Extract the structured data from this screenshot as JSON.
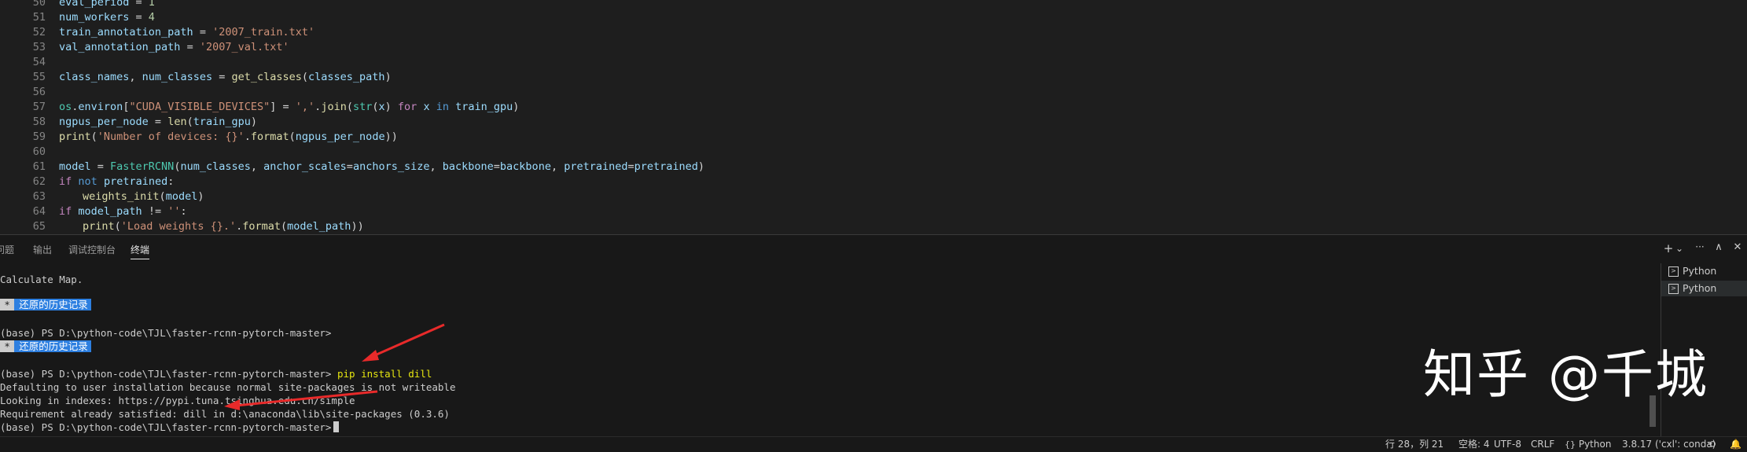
{
  "editor": {
    "lines": [
      {
        "n": "50",
        "tokens": [
          [
            "var",
            "eval_period"
          ],
          [
            "op",
            " = "
          ],
          [
            "num",
            "1"
          ]
        ],
        "indent": 1
      },
      {
        "n": "51",
        "tokens": [
          [
            "var",
            "num_workers"
          ],
          [
            "op",
            " = "
          ],
          [
            "num",
            "4"
          ]
        ],
        "indent": 1
      },
      {
        "n": "52",
        "tokens": [
          [
            "var",
            "train_annotation_path"
          ],
          [
            "op",
            " = "
          ],
          [
            "str",
            "'2007_train.txt'"
          ]
        ],
        "indent": 1
      },
      {
        "n": "53",
        "tokens": [
          [
            "var",
            "val_annotation_path"
          ],
          [
            "op",
            " = "
          ],
          [
            "str",
            "'2007_val.txt'"
          ]
        ],
        "indent": 1
      },
      {
        "n": "54",
        "tokens": [],
        "indent": 1
      },
      {
        "n": "55",
        "tokens": [
          [
            "var",
            "class_names"
          ],
          [
            "op",
            ", "
          ],
          [
            "var",
            "num_classes"
          ],
          [
            "op",
            " = "
          ],
          [
            "fn",
            "get_classes"
          ],
          [
            "op",
            "("
          ],
          [
            "var",
            "classes_path"
          ],
          [
            "op",
            ")"
          ]
        ],
        "indent": 1
      },
      {
        "n": "56",
        "tokens": [],
        "indent": 1
      },
      {
        "n": "57",
        "tokens": [
          [
            "bi",
            "os"
          ],
          [
            "op",
            "."
          ],
          [
            "var",
            "environ"
          ],
          [
            "op",
            "["
          ],
          [
            "str",
            "\"CUDA_VISIBLE_DEVICES\""
          ],
          [
            "op",
            "] = "
          ],
          [
            "str",
            "','"
          ],
          [
            "op",
            "."
          ],
          [
            "fn",
            "join"
          ],
          [
            "op",
            "("
          ],
          [
            "bi",
            "str"
          ],
          [
            "op",
            "("
          ],
          [
            "var",
            "x"
          ],
          [
            "op",
            ") "
          ],
          [
            "kw",
            "for"
          ],
          [
            "op",
            " "
          ],
          [
            "var",
            "x"
          ],
          [
            "op",
            " "
          ],
          [
            "kwb",
            "in"
          ],
          [
            "op",
            " "
          ],
          [
            "var",
            "train_gpu"
          ],
          [
            "op",
            ")"
          ]
        ],
        "indent": 1
      },
      {
        "n": "58",
        "tokens": [
          [
            "var",
            "ngpus_per_node"
          ],
          [
            "op",
            " = "
          ],
          [
            "fn",
            "len"
          ],
          [
            "op",
            "("
          ],
          [
            "var",
            "train_gpu"
          ],
          [
            "op",
            ")"
          ]
        ],
        "indent": 1
      },
      {
        "n": "59",
        "tokens": [
          [
            "fn",
            "print"
          ],
          [
            "op",
            "("
          ],
          [
            "str",
            "'Number of devices: {}'"
          ],
          [
            "op",
            "."
          ],
          [
            "fn",
            "format"
          ],
          [
            "op",
            "("
          ],
          [
            "var",
            "ngpus_per_node"
          ],
          [
            "op",
            "))"
          ]
        ],
        "indent": 1
      },
      {
        "n": "60",
        "tokens": [],
        "indent": 1
      },
      {
        "n": "61",
        "tokens": [
          [
            "var",
            "model"
          ],
          [
            "op",
            " = "
          ],
          [
            "bi",
            "FasterRCNN"
          ],
          [
            "op",
            "("
          ],
          [
            "var",
            "num_classes"
          ],
          [
            "op",
            ", "
          ],
          [
            "var",
            "anchor_scales"
          ],
          [
            "op",
            "="
          ],
          [
            "var",
            "anchors_size"
          ],
          [
            "op",
            ", "
          ],
          [
            "var",
            "backbone"
          ],
          [
            "op",
            "="
          ],
          [
            "var",
            "backbone"
          ],
          [
            "op",
            ", "
          ],
          [
            "var",
            "pretrained"
          ],
          [
            "op",
            "="
          ],
          [
            "var",
            "pretrained"
          ],
          [
            "op",
            ")"
          ]
        ],
        "indent": 1
      },
      {
        "n": "62",
        "tokens": [
          [
            "kw",
            "if"
          ],
          [
            "op",
            " "
          ],
          [
            "kwb",
            "not"
          ],
          [
            "op",
            " "
          ],
          [
            "var",
            "pretrained"
          ],
          [
            "op",
            ":"
          ]
        ],
        "indent": 1
      },
      {
        "n": "63",
        "tokens": [
          [
            "fn",
            "weights_init"
          ],
          [
            "op",
            "("
          ],
          [
            "var",
            "model"
          ],
          [
            "op",
            ")"
          ]
        ],
        "indent": 2
      },
      {
        "n": "64",
        "tokens": [
          [
            "kw",
            "if"
          ],
          [
            "op",
            " "
          ],
          [
            "var",
            "model_path"
          ],
          [
            "op",
            " != "
          ],
          [
            "str",
            "''"
          ],
          [
            "op",
            ":"
          ]
        ],
        "indent": 1
      },
      {
        "n": "65",
        "tokens": [
          [
            "fn",
            "print"
          ],
          [
            "op",
            "("
          ],
          [
            "str",
            "'Load weights {}.'"
          ],
          [
            "op",
            "."
          ],
          [
            "fn",
            "format"
          ],
          [
            "op",
            "("
          ],
          [
            "var",
            "model_path"
          ],
          [
            "op",
            "))"
          ]
        ],
        "indent": 2
      }
    ]
  },
  "panel": {
    "tabs": [
      {
        "label": "问题",
        "active": false
      },
      {
        "label": "输出",
        "active": false
      },
      {
        "label": "调试控制台",
        "active": false
      },
      {
        "label": "终端",
        "active": true
      }
    ],
    "actions": {
      "add": "+",
      "dropdown": "⌄",
      "more": "···",
      "maximize": "∧",
      "close": "✕"
    }
  },
  "terminal": {
    "calc_line": "Calculate Map.",
    "badge_star": "*",
    "badge_text": "还原的历史记录",
    "prompt": "(base) PS D:\\python-code\\TJL\\faster-rcnn-pytorch-master>",
    "command": "pip install dill",
    "output": [
      "Defaulting to user installation because normal site-packages is not writeable",
      "Looking in indexes: https://pypi.tuna.tsinghua.edu.cn/simple",
      "Requirement already satisfied: dill in d:\\anaconda\\lib\\site-packages (0.3.6)"
    ]
  },
  "sessions": [
    {
      "label": "Python",
      "active": false
    },
    {
      "label": "Python",
      "active": true
    }
  ],
  "watermark": "知乎 @千城",
  "statusbar": {
    "position": "行 28，列 21",
    "spaces": "空格: 4",
    "encoding": "UTF-8",
    "eol": "CRLF",
    "language": "Python",
    "interpreter": "3.8.17 ('cxl': conda)"
  },
  "colors": {
    "editor_bg": "#1e1e1e",
    "panel_bg": "#181818",
    "badge_blue": "#2d7fe0",
    "annotation_red": "#e82a2a",
    "command_yellow": "#e5e510"
  }
}
